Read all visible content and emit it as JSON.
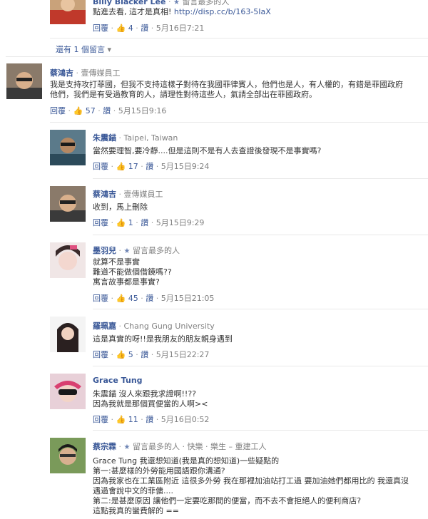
{
  "actions": {
    "reply": "回覆",
    "like_icon": "thumbs-up-icon",
    "speech_icon": "speech-bubble-icon"
  },
  "top_comment": {
    "name": "Billy Blacker Lee",
    "badge": "留言最多的人",
    "text": "點進去看, 這才是真相!",
    "link": "http://disp.cc/b/163-5IaX",
    "likes": "4",
    "timestamp": "5月16日7:21"
  },
  "more_replies": "還有 1 個留言",
  "comments": [
    {
      "name": "蔡鴻吉",
      "affiliation": "壹傳媒員工",
      "lines": [
        "我是支持攻打菲國，但我不支持這樣子對待在我國菲律賓人，他們也是人，有人權的，有錯是菲國政府",
        "他們，我們是有受過教育的人，請理性對待這些人，氣請全部出在菲國政府。"
      ],
      "likes": "57",
      "timestamp": "5月15日9:16"
    },
    {
      "name": "朱震錨",
      "affiliation": "Taipei, Taiwan",
      "lines": [
        "當然要理智,要冷靜....但是這則不是有人去查證後發現不是事實嗎?"
      ],
      "likes": "17",
      "timestamp": "5月15日9:24"
    },
    {
      "name": "蔡鴻吉",
      "affiliation": "壹傳媒員工",
      "lines": [
        "收到，馬上刪除"
      ],
      "likes": "1",
      "timestamp": "5月15日9:29"
    },
    {
      "name": "墨羽兒",
      "affiliation": "留言最多的人",
      "lines": [
        "就算不是事實",
        "難道不能做個借鏡嗎??",
        "寓言故事都是事實?"
      ],
      "likes": "45",
      "timestamp": "5月15日21:05"
    },
    {
      "name": "羅珮嘉",
      "affiliation": "Chang Gung University",
      "lines": [
        "這是真實的呀!!是我朋友的朋友親身遇到"
      ],
      "likes": "5",
      "timestamp": "5月15日22:27"
    },
    {
      "name": "Grace Tung",
      "affiliation": "",
      "lines": [
        "朱震錨 沒人來跟我求證啊!!??",
        "因為我就是那個買便當的人啊><"
      ],
      "likes": "11",
      "timestamp": "5月16日0:52"
    },
    {
      "name": "蔡宗霖",
      "affiliation": "留言最多的人 · 快樂 · 樂生 – 重建工人",
      "lines": [
        "Grace Tung 我還想知道(我是真的想知道)一些疑點的",
        "第一:甚麼樣的外勞能用國語跟你溝通?",
        "因為我家也在工業區附近 這很多外勞 我在那裡加油站打工過 要加油她們都用比的 我還真沒",
        "遇過會說中文的菲傭....",
        "第二:是甚麼原因 讓他們一定要吃那間的便當，而不去不會拒絕人的便利商店?",
        "這點我真的蠻費解的 =="
      ]
    }
  ]
}
